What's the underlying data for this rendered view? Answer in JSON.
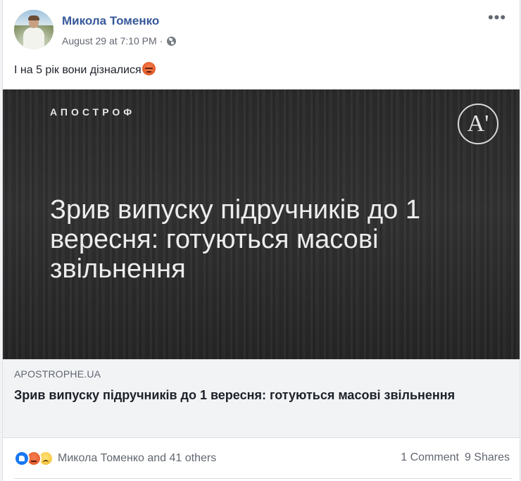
{
  "post": {
    "author": "Микола Томенко",
    "timestamp": "August 29 at 7:10 PM",
    "separator": "·",
    "privacy_icon": "globe-icon",
    "more_label": "•••",
    "text": "І на 5 рік вони дізналися",
    "text_emoji": "angry-face-icon"
  },
  "link_preview": {
    "brand": "АПОСТРОФ",
    "logo": "A'",
    "image_headline": "Зрив випуску підручників до 1 вересня: готуються масові звільнення",
    "domain": "APOSTROPHE.UA",
    "title": "Зрив випуску підручників до 1 вересня: готуються масові звільнення"
  },
  "footer": {
    "reaction_icons": [
      "like-icon",
      "angry-icon",
      "sad-icon"
    ],
    "reaction_text": "Микола Томенко and 41 others",
    "comments": "1 Comment",
    "shares": "9 Shares"
  },
  "colors": {
    "author_link": "#365899",
    "secondary_text": "#616770",
    "preview_background": "#2b2b2b",
    "link_info_background": "#f2f3f5"
  }
}
